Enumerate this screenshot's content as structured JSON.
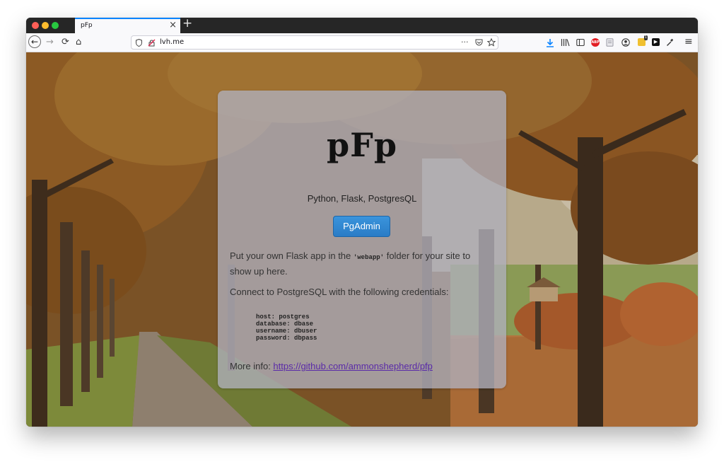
{
  "browser": {
    "tab_title": "pFp",
    "tab_close": "×",
    "new_tab": "+",
    "url": "lvh.me",
    "nav_back": "←",
    "nav_forward": "→",
    "nav_reload": "⟳",
    "nav_home": "⌂",
    "page_actions": "···",
    "abp_label": "ABP",
    "ext_badge_count": "1",
    "menu": "≡"
  },
  "page": {
    "logo": "pFp",
    "subtitle": "Python, Flask, PostgresQL",
    "pgadmin_button": "PgAdmin",
    "intro_before": "Put your own Flask app in the ",
    "intro_code": "'webapp'",
    "intro_after": " folder for your site to show up here.",
    "connect_text": "Connect to PostgreSQL with the following credentials:",
    "credentials": "host: postgres\ndatabase: dbase\nusername: dbuser\npassword: dbpass",
    "more_info_label": "More info: ",
    "more_info_link": "https://github.com/ammonshepherd/pfp"
  },
  "colors": {
    "accent": "#0a84ff",
    "button": "#2a7cc6",
    "link": "#5a2aa8"
  }
}
